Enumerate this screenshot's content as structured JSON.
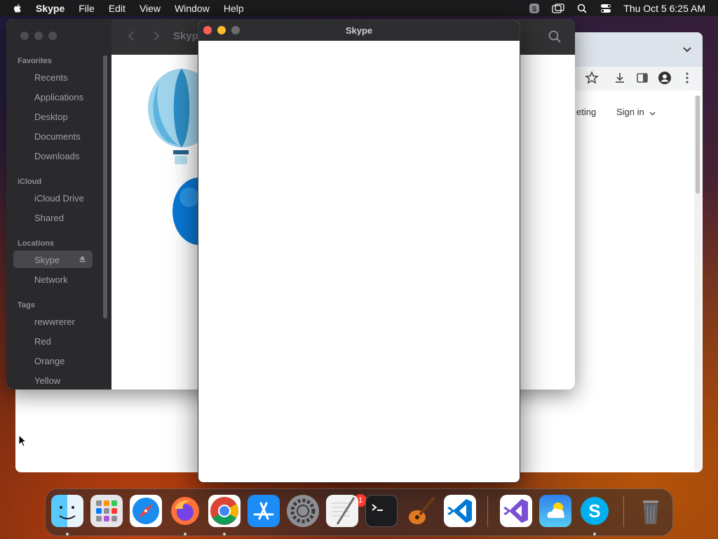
{
  "menubar": {
    "app_name": "Skype",
    "items": [
      "File",
      "Edit",
      "View",
      "Window",
      "Help"
    ],
    "clock": "Thu Oct 5  6:25 AM"
  },
  "finder": {
    "title": "Skyp",
    "sidebar": {
      "favorites_heading": "Favorites",
      "favorites": [
        "Recents",
        "Applications",
        "Desktop",
        "Documents",
        "Downloads"
      ],
      "icloud_heading": "iCloud",
      "icloud": [
        "iCloud Drive",
        "Shared"
      ],
      "locations_heading": "Locations",
      "locations": [
        "Skype",
        "Network"
      ],
      "tags_heading": "Tags",
      "tags": [
        "rewwrerer",
        "Red",
        "Orange",
        "Yellow"
      ]
    }
  },
  "chrome": {
    "nav_partial": "eting",
    "sign_in": "Sign in"
  },
  "skype_window": {
    "title": "Skype"
  },
  "dock": {
    "items": [
      "Finder",
      "Launchpad",
      "Safari",
      "Firefox",
      "Chrome",
      "App Store",
      "System Settings",
      "TextEdit",
      "Terminal",
      "GarageBand",
      "Visual Studio Code",
      "Visual Studio",
      "Weather",
      "Skype",
      "Trash"
    ],
    "settings_badge": "1"
  },
  "colors": {
    "close": "#ff5f57",
    "minimize": "#febc2e",
    "zoom": "#28c840"
  }
}
